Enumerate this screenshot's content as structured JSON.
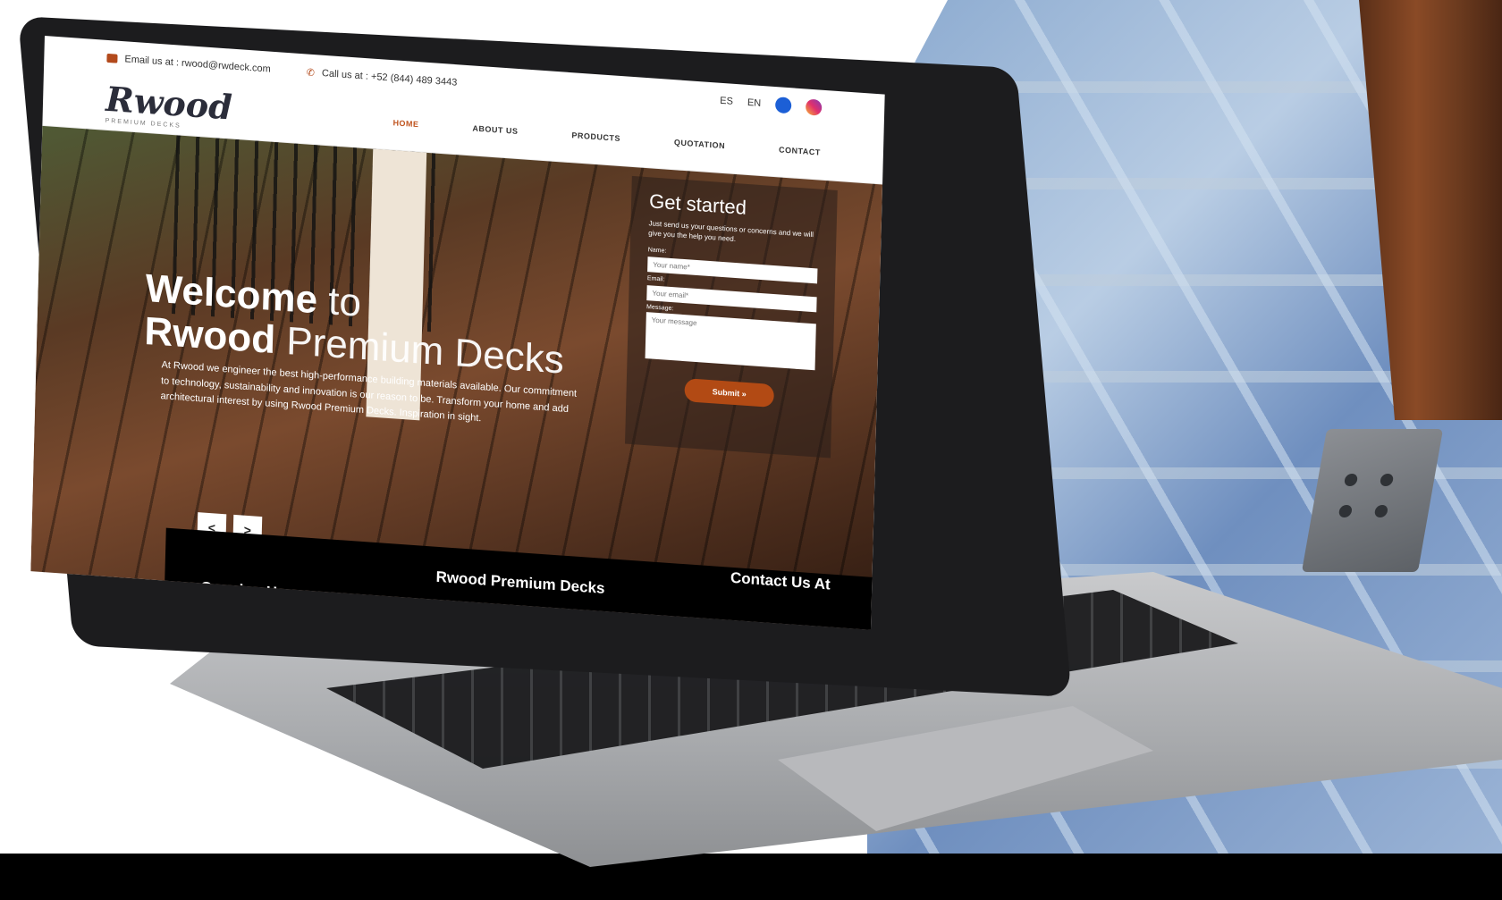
{
  "topbar": {
    "email": "Email us at : rwood@rwdeck.com",
    "phone": "Call us at : +52 (844) 489 3443",
    "lang_es": "ES",
    "lang_en": "EN"
  },
  "brand": {
    "logo": "Rwood",
    "tagline": "PREMIUM DECKS"
  },
  "nav": {
    "items": [
      {
        "label": "HOME",
        "active": true
      },
      {
        "label": "ABOUT US",
        "active": false
      },
      {
        "label": "PRODUCTS",
        "active": false
      },
      {
        "label": "QUOTATION",
        "active": false
      },
      {
        "label": "CONTACT",
        "active": false
      }
    ]
  },
  "hero": {
    "title_bold_1": "Welcome",
    "title_light_1": "to",
    "title_bold_2": "Rwood",
    "title_light_2": "Premium Decks",
    "text": "At Rwood we engineer the best high-performance building materials available. Our commitment to technology, sustainability and innovation is our reason to be. Transform your home and add architectural interest by using Rwood Premium Decks. Inspiration in sight.",
    "prev": "<",
    "next": ">"
  },
  "form": {
    "title": "Get started",
    "subtitle": "Just send us your questions or concerns and we will give you the help you need.",
    "name_label": "Name:",
    "name_placeholder": "Your name*",
    "email_label": "Email:",
    "email_placeholder": "Your email*",
    "message_label": "Message:",
    "message_placeholder": "Your message",
    "submit": "Submit »"
  },
  "footer": {
    "col1": "Opening Hours",
    "col2": "Rwood Premium Decks",
    "col3": "Contact Us At"
  },
  "colors": {
    "accent": "#c0541f",
    "submit": "#b24a14",
    "facebook": "#1c5fd6"
  }
}
